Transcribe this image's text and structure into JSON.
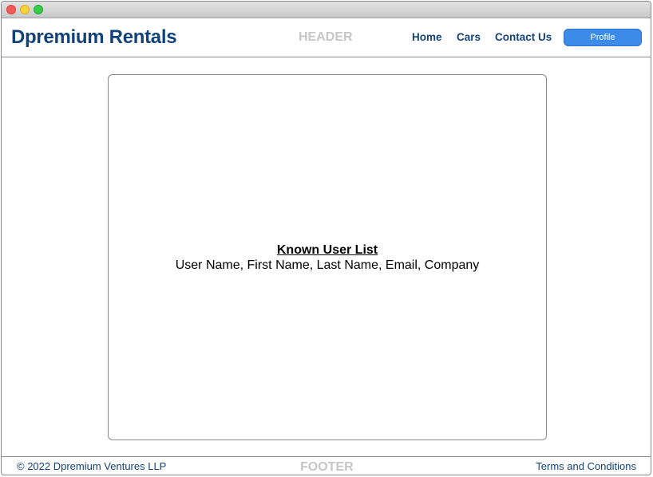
{
  "window": {
    "controls": [
      "close",
      "minimize",
      "maximize"
    ]
  },
  "header": {
    "brand": "Dpremium Rentals",
    "region_label": "HEADER",
    "nav": {
      "home": "Home",
      "cars": "Cars",
      "contact": "Contact Us"
    },
    "profile_button": "Profile"
  },
  "main": {
    "title": "Known User List",
    "fields": "User Name, First Name, Last Name, Email, Company"
  },
  "footer": {
    "copyright": "© 2022 Dpremium Ventures LLP",
    "region_label": "FOOTER",
    "terms_link": "Terms and Conditions"
  },
  "colors": {
    "brand": "#12427a",
    "accent_button": "#3d8be8",
    "region_label": "#c6c6c6",
    "border": "#8a8a8a"
  }
}
